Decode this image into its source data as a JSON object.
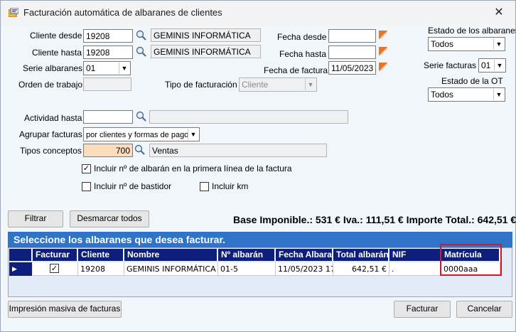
{
  "window": {
    "title": "Facturación automática de albaranes de clientes",
    "close": "✕"
  },
  "labels": {
    "cliente_desde": "Cliente desde",
    "cliente_hasta": "Cliente hasta",
    "serie_albaranes": "Serie albaranes",
    "orden_trabajo": "Orden de trabajo",
    "tipo_facturacion": "Tipo de facturación",
    "fecha_desde": "Fecha desde",
    "fecha_hasta": "Fecha hasta",
    "fecha_factura": "Fecha de factura",
    "estado_albaranes": "Estado de los albaranes",
    "serie_facturas": "Serie facturas",
    "estado_ot": "Estado de la OT",
    "actividad_hasta": "Actividad hasta",
    "agrupar_facturas": "Agrupar facturas",
    "tipos_conceptos": "Tipos conceptos"
  },
  "fields": {
    "cliente_desde_code": "19208",
    "cliente_desde_name": "GEMINIS INFORMÁTICA",
    "cliente_hasta_code": "19208",
    "cliente_hasta_name": "GEMINIS INFORMÁTICA",
    "serie_albaranes": "01",
    "orden_trabajo": "",
    "tipo_facturacion": "Cliente",
    "fecha_desde": "",
    "fecha_hasta": "",
    "fecha_factura": "11/05/2023",
    "estado_albaranes": "Todos",
    "serie_facturas": "01",
    "estado_ot": "Todos",
    "actividad_hasta_code": "",
    "actividad_hasta_name": "",
    "agrupar_facturas": "por clientes y formas de pago",
    "tipos_conceptos_code": "700",
    "tipos_conceptos_name": "Ventas"
  },
  "checkboxes": {
    "incluir_albaran": {
      "label": "Incluir nº de albarán en la primera línea de la factura",
      "checked": true,
      "mark": "✓"
    },
    "incluir_bastidor": {
      "label": "Incluir nº de bastidor",
      "checked": false
    },
    "incluir_km": {
      "label": "Incluir km",
      "checked": false
    }
  },
  "buttons": {
    "filtrar": "Filtrar",
    "desmarcar": "Desmarcar todos",
    "impresion": "Impresión masiva de facturas",
    "facturar": "Facturar",
    "cancelar": "Cancelar"
  },
  "totals": "Base Imponible.: 531 € Iva.: 111,51 € Importe Total.: 642,51 €",
  "banner": "Seleccione los albaranes que desea facturar.",
  "table": {
    "columns": [
      "Facturar",
      "Cliente",
      "Nombre",
      "Nº albarán",
      "Fecha Albara",
      "Total albarán",
      "NIF",
      "Matrícula"
    ],
    "rows": [
      {
        "row_marker": "▶",
        "facturar": "✓",
        "cliente": "19208",
        "nombre": "GEMINIS INFORMÁTICA",
        "albaran": "01-5",
        "fecha": "11/05/2023 17",
        "total": "642,51 €",
        "nif": ".",
        "matricula": "0000aaa"
      }
    ]
  },
  "colors": {
    "accent_blue": "#2f74c8",
    "header_navy": "#0d1f7b",
    "highlight_red": "#e0141e"
  }
}
